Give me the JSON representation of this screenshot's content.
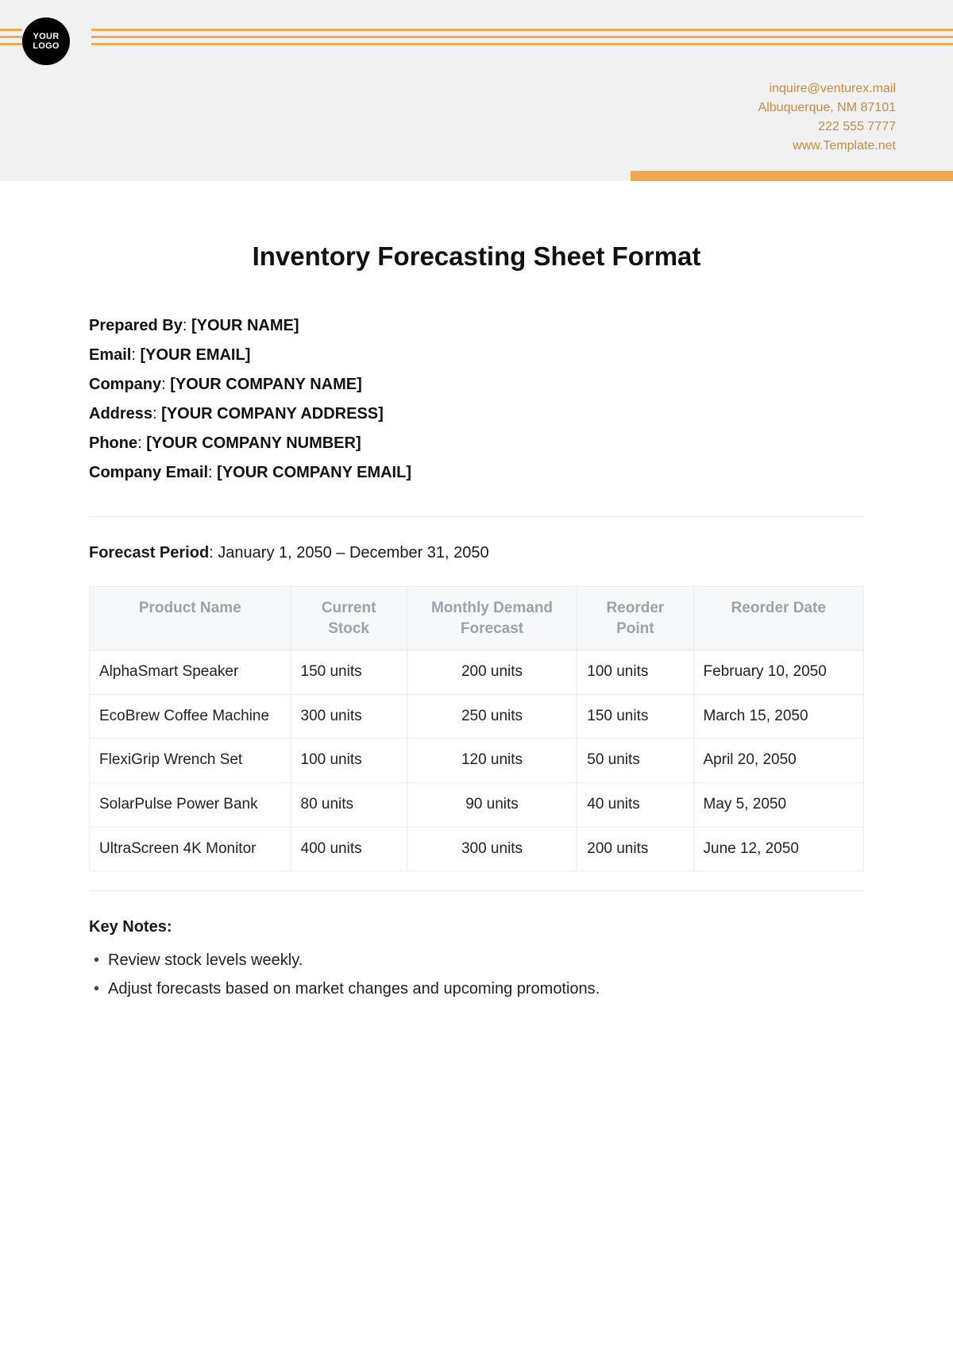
{
  "logo": {
    "line1": "YOUR",
    "line2": "LOGO"
  },
  "contact": {
    "email": "inquire@venturex.mail",
    "address": "Albuquerque, NM 87101",
    "phone": "222 555 7777",
    "website": "www.Template.net"
  },
  "title": "Inventory Forecasting Sheet Format",
  "meta": {
    "prepared_by": {
      "label": "Prepared By",
      "value": "[YOUR NAME]"
    },
    "email": {
      "label": "Email",
      "value": "[YOUR EMAIL]"
    },
    "company": {
      "label": "Company",
      "value": "[YOUR COMPANY NAME]"
    },
    "address": {
      "label": "Address",
      "value": "[YOUR COMPANY ADDRESS]"
    },
    "phone": {
      "label": "Phone",
      "value": "[YOUR COMPANY NUMBER]"
    },
    "company_email": {
      "label": "Company Email",
      "value": "[YOUR COMPANY EMAIL]"
    }
  },
  "forecast_period": {
    "label": "Forecast Period",
    "value": "January 1, 2050 – December 31, 2050"
  },
  "table": {
    "headers": [
      "Product Name",
      "Current Stock",
      "Monthly Demand Forecast",
      "Reorder Point",
      "Reorder Date"
    ],
    "rows": [
      {
        "name": "AlphaSmart Speaker",
        "stock": "150 units",
        "demand": "200 units",
        "reorder_point": "100 units",
        "reorder_date": "February 10, 2050"
      },
      {
        "name": "EcoBrew Coffee Machine",
        "stock": "300 units",
        "demand": "250 units",
        "reorder_point": "150 units",
        "reorder_date": "March 15, 2050"
      },
      {
        "name": "FlexiGrip Wrench Set",
        "stock": "100 units",
        "demand": "120 units",
        "reorder_point": "50 units",
        "reorder_date": "April 20, 2050"
      },
      {
        "name": "SolarPulse Power Bank",
        "stock": "80 units",
        "demand": "90 units",
        "reorder_point": "40 units",
        "reorder_date": "May 5, 2050"
      },
      {
        "name": "UltraScreen 4K Monitor",
        "stock": "400 units",
        "demand": "300 units",
        "reorder_point": "200 units",
        "reorder_date": "June 12, 2050"
      }
    ]
  },
  "notes": {
    "title": "Key Notes",
    "items": [
      "Review stock levels weekly.",
      "Adjust forecasts based on market changes and upcoming promotions."
    ]
  }
}
